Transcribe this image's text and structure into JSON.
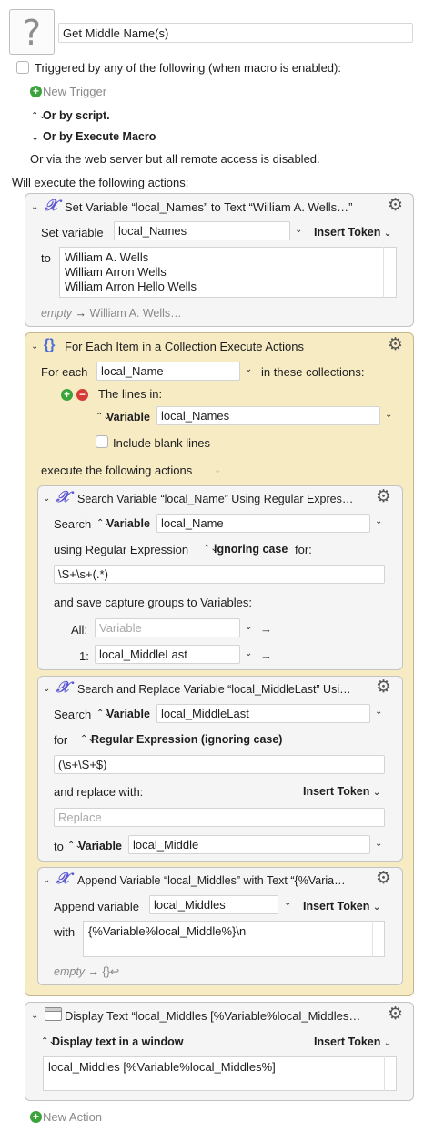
{
  "macro": {
    "icon": "question-mark-icon",
    "title": "Get Middle Name(s)"
  },
  "triggers": {
    "triggered_label": "Triggered by any of the following (when macro is enabled):",
    "new_trigger": "New Trigger",
    "or_by_script": "Or by script.",
    "or_by_execute_macro": "Or by Execute Macro",
    "web_server_note": "Or via the web server but all remote access is disabled."
  },
  "will_execute": "Will execute the following actions:",
  "action1": {
    "title": "Set Variable “local_Names” to Text “William A. Wells…”",
    "set_variable_label": "Set variable",
    "variable_value": "local_Names",
    "insert_token": "Insert Token",
    "to_label": "to",
    "text_lines": [
      "William A. Wells",
      "William Arron Wells",
      "William Arron Hello Wells"
    ],
    "preview_empty": "empty",
    "preview_value": "William A. Wells…"
  },
  "action2": {
    "title": "For Each Item in a Collection Execute Actions",
    "for_each_label": "For each",
    "item_variable": "local_Name",
    "in_collections_label": "in these collections:",
    "lines_in_label": "The lines in:",
    "variable_label": "Variable",
    "collection_variable": "local_Names",
    "include_blank": "Include blank lines",
    "execute_following": "execute the following actions"
  },
  "action3": {
    "title": "Search Variable “local_Name” Using Regular Expres…",
    "search_label": "Search",
    "variable_label": "Variable",
    "variable_value": "local_Name",
    "using_regex_label": "using Regular Expression",
    "ignoring_case": "ignoring case",
    "for_label": "for:",
    "regex": "\\S+\\s+(.*)",
    "save_groups_label": "and save capture groups to Variables:",
    "all_label": "All:",
    "all_placeholder": "Variable",
    "group1_label": "1:",
    "group1_value": "local_MiddleLast"
  },
  "action4": {
    "title": "Search and Replace Variable “local_MiddleLast” Usi…",
    "search_label": "Search",
    "variable_label": "Variable",
    "variable_value": "local_MiddleLast",
    "for_label": "for",
    "regex_mode": "Regular Expression (ignoring case)",
    "regex": "(\\s+\\S+$)",
    "replace_with_label": "and replace with:",
    "insert_token": "Insert Token",
    "replace_placeholder": "Replace",
    "to_label": "to",
    "to_variable_label": "Variable",
    "to_variable_value": "local_Middle"
  },
  "action5": {
    "title": "Append Variable “local_Middles” with Text “{%Varia…",
    "append_label": "Append variable",
    "variable_value": "local_Middles",
    "insert_token": "Insert Token",
    "with_label": "with",
    "text": "{%Variable%local_Middle%}\\n",
    "preview_empty": "empty",
    "preview_value": "{}↩"
  },
  "action6": {
    "title": "Display Text “local_Middles [%Variable%local_Middles…",
    "mode": "Display text in a window",
    "insert_token": "Insert Token",
    "text": "local_Middles [%Variable%local_Middles%]"
  },
  "new_action": "New Action"
}
